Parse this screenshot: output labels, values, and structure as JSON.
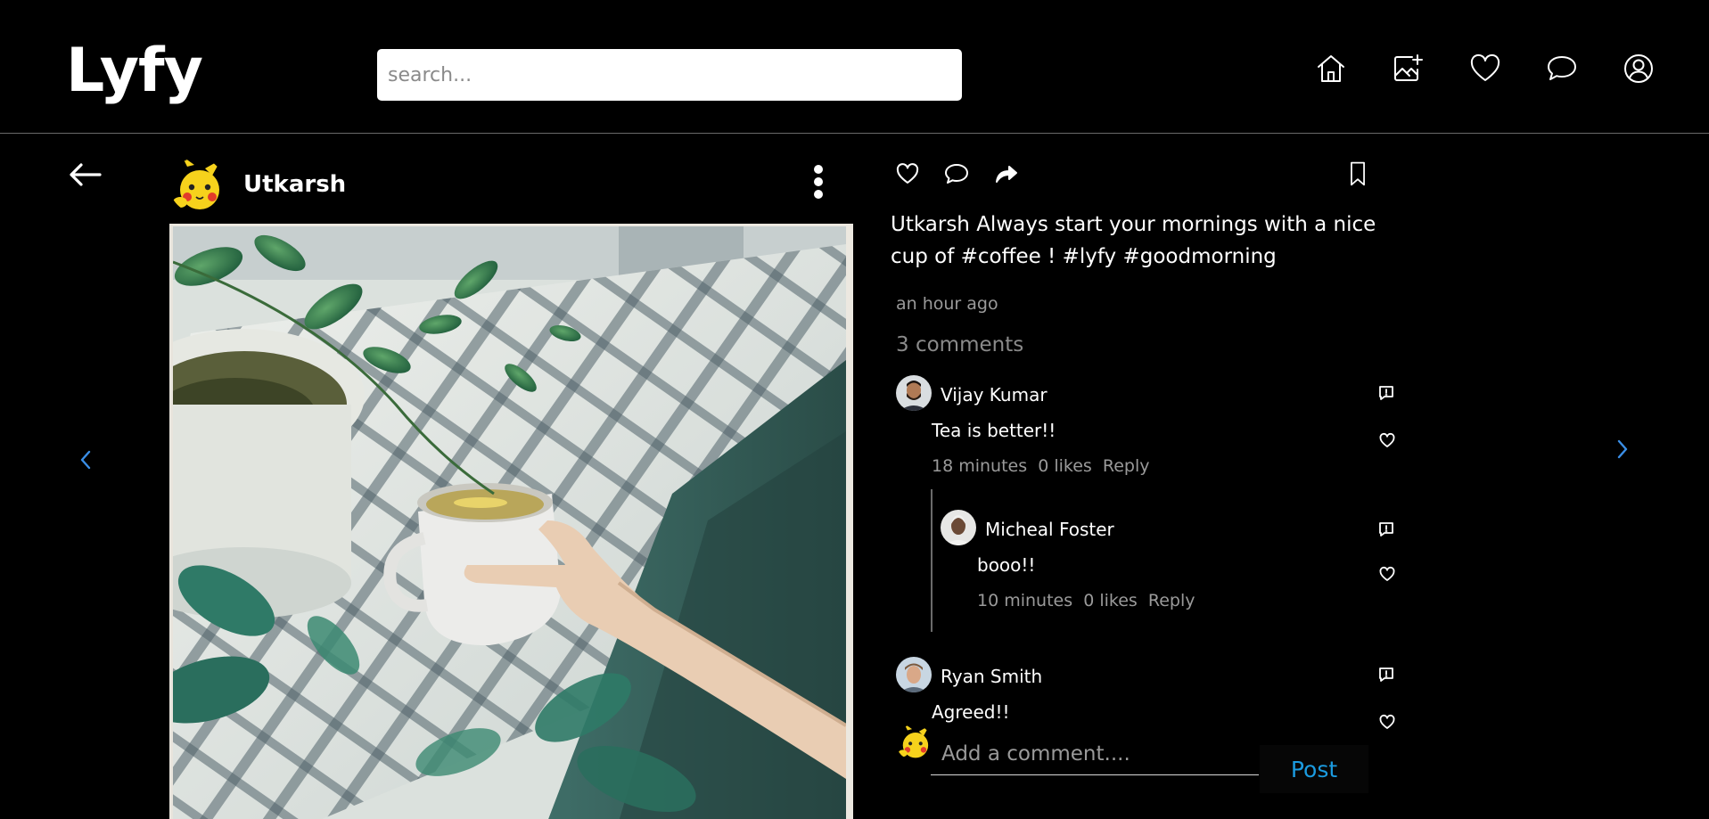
{
  "app": {
    "logo": "Lyfy"
  },
  "search": {
    "placeholder": "search..."
  },
  "nav": {
    "icons": [
      "home-icon",
      "add-image-icon",
      "heart-icon",
      "chat-icon",
      "profile-icon"
    ]
  },
  "post": {
    "username": "Utkarsh",
    "caption": "Utkarsh Always start your mornings with a nice cup of #coffee ! #lyfy #goodmorning",
    "time": "an hour ago",
    "comments_count": "3 comments"
  },
  "comments": [
    {
      "name": "Vijay Kumar",
      "text": "Tea is better!!",
      "age": "18 minutes",
      "likes": "0 likes",
      "reply": "Reply"
    },
    {
      "name": "Micheal Foster",
      "text": "booo!!",
      "age": "10 minutes",
      "likes": "0 likes",
      "reply": "Reply"
    },
    {
      "name": "Ryan Smith",
      "text": "Agreed!!"
    }
  ],
  "add_comment": {
    "placeholder": "Add a comment....",
    "post_label": "Post"
  },
  "colors": {
    "accent": "#1b9be0",
    "chevron": "#3a8ee6",
    "background": "#000000"
  }
}
